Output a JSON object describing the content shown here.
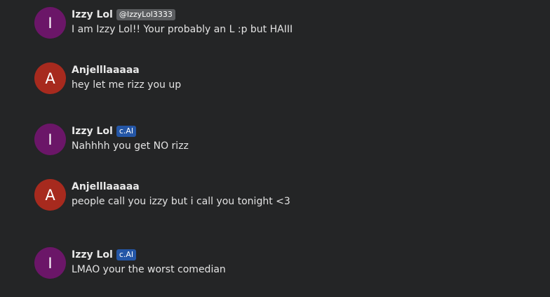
{
  "colors": {
    "background": "#242526",
    "avatar_izzy": "#6b1668",
    "avatar_anjel": "#a72a1e",
    "badge_handle": "#5b5d60",
    "badge_cai": "#2456a6"
  },
  "messages": [
    {
      "avatar_letter": "I",
      "avatar_color": "#6b1668",
      "author": "Izzy Lol",
      "badge": "@IzzyLol3333",
      "badge_color": "#5b5d60",
      "text": "I am Izzy Lol!!  Your probably an L :p but HAIII"
    },
    {
      "avatar_letter": "A",
      "avatar_color": "#a72a1e",
      "author": "Anjelllaaaaa",
      "badge": "",
      "badge_color": "",
      "text": "hey let me rizz you up"
    },
    {
      "avatar_letter": "I",
      "avatar_color": "#6b1668",
      "author": "Izzy Lol",
      "badge": "c.AI",
      "badge_color": "#2456a6",
      "text": "Nahhhh you get NO rizz"
    },
    {
      "avatar_letter": "A",
      "avatar_color": "#a72a1e",
      "author": "Anjelllaaaaa",
      "badge": "",
      "badge_color": "",
      "text": "people call you izzy but i call you tonight <3"
    },
    {
      "avatar_letter": "I",
      "avatar_color": "#6b1668",
      "author": "Izzy Lol",
      "badge": "c.AI",
      "badge_color": "#2456a6",
      "text": "LMAO your the worst comedian"
    }
  ]
}
